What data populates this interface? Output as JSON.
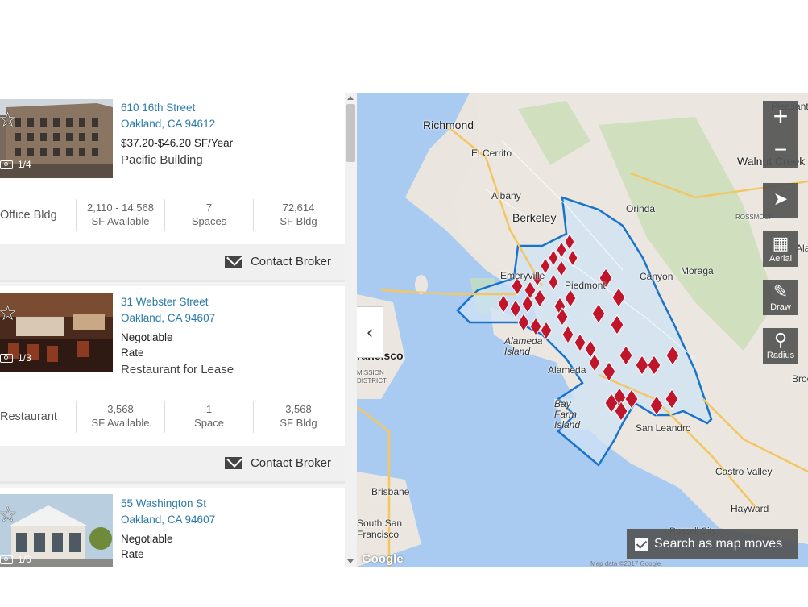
{
  "listings": [
    {
      "address_line1": "610 16th Street",
      "address_line2": "Oakland, CA 94612",
      "info": [
        "$37.20-$46.20 SF/Year"
      ],
      "name": "Pacific Building",
      "photo_count": "1/4",
      "type": "Office Bldg",
      "stats": [
        {
          "value": "2,110 - 14,568",
          "label": "SF Available"
        },
        {
          "value": "7",
          "label": "Spaces"
        },
        {
          "value": "72,614",
          "label": "SF Bldg"
        }
      ],
      "contact_label": "Contact Broker"
    },
    {
      "address_line1": "31 Webster Street",
      "address_line2": "Oakland, CA 94607",
      "info": [
        "Negotiable",
        "Rate"
      ],
      "name": "Restaurant for Lease",
      "photo_count": "1/3",
      "type": "Restaurant",
      "stats": [
        {
          "value": "3,568",
          "label": "SF Available"
        },
        {
          "value": "1",
          "label": "Space"
        },
        {
          "value": "3,568",
          "label": "SF Bldg"
        }
      ],
      "contact_label": "Contact Broker"
    },
    {
      "address_line1": "55 Washington St",
      "address_line2": "Oakland, CA 94607",
      "info": [
        "Negotiable",
        "Rate"
      ],
      "photo_count": "1/6"
    }
  ],
  "map": {
    "labels": {
      "richmond": "Richmond",
      "el_cerrito": "El Cerrito",
      "albany": "Albany",
      "berkeley": "Berkeley",
      "orinda": "Orinda",
      "canyon": "Canyon",
      "moraga": "Moraga",
      "emeryville": "Emeryville",
      "piedmont": "Piedmont",
      "alameda_island": "Alameda Island",
      "alameda": "Alameda",
      "bay_farm": "Bay Farm Island",
      "san_leandro": "San Leandro",
      "castro_valley": "Castro Valley",
      "hayward": "Hayward",
      "brisbane": "Brisbane",
      "south_sf": "South San Francisco",
      "san_francisco": "rancisco",
      "mission_district": "MISSION DISTRICT",
      "pleasant_hill": "Pleasant Hill",
      "walnut_creek": "Walnut Creek",
      "rossmoor": "ROSSMOOR",
      "russell_city": "Russell City",
      "broo": "Broo",
      "alan": "Ala"
    },
    "controls": {
      "zoom_in": "+",
      "zoom_out": "−",
      "aerial": "Aerial",
      "draw": "Draw",
      "radius": "Radius"
    },
    "search_as_moves": "Search as map moves",
    "google": "Google",
    "map_data": "Map data ©2017 Google",
    "colors": {
      "water": "#aacbf1",
      "land": "#ebe7e0",
      "boundary": "#1a73c9",
      "pin": "#c0162c"
    }
  }
}
